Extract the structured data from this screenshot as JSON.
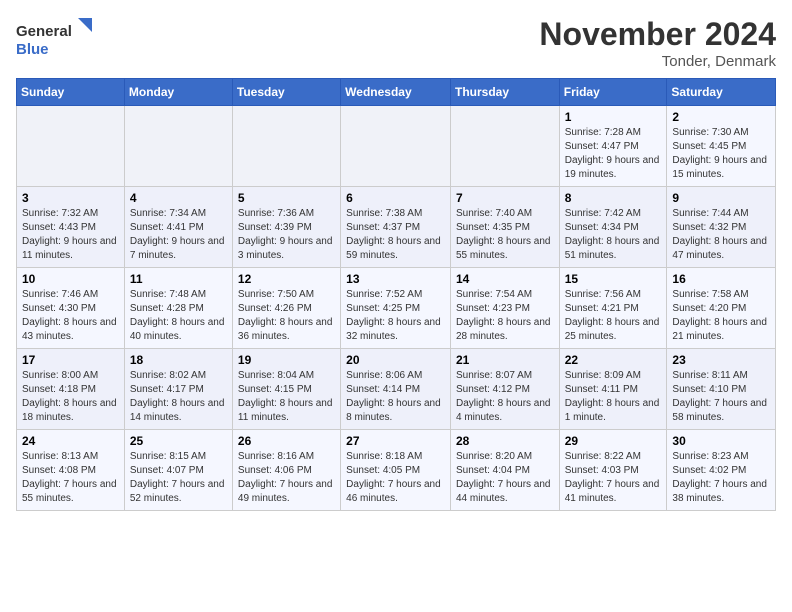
{
  "logo": {
    "line1": "General",
    "line2": "Blue"
  },
  "title": "November 2024",
  "location": "Tonder, Denmark",
  "days_of_week": [
    "Sunday",
    "Monday",
    "Tuesday",
    "Wednesday",
    "Thursday",
    "Friday",
    "Saturday"
  ],
  "weeks": [
    [
      {
        "day": "",
        "sunrise": "",
        "sunset": "",
        "daylight": ""
      },
      {
        "day": "",
        "sunrise": "",
        "sunset": "",
        "daylight": ""
      },
      {
        "day": "",
        "sunrise": "",
        "sunset": "",
        "daylight": ""
      },
      {
        "day": "",
        "sunrise": "",
        "sunset": "",
        "daylight": ""
      },
      {
        "day": "",
        "sunrise": "",
        "sunset": "",
        "daylight": ""
      },
      {
        "day": "1",
        "sunrise": "Sunrise: 7:28 AM",
        "sunset": "Sunset: 4:47 PM",
        "daylight": "Daylight: 9 hours and 19 minutes."
      },
      {
        "day": "2",
        "sunrise": "Sunrise: 7:30 AM",
        "sunset": "Sunset: 4:45 PM",
        "daylight": "Daylight: 9 hours and 15 minutes."
      }
    ],
    [
      {
        "day": "3",
        "sunrise": "Sunrise: 7:32 AM",
        "sunset": "Sunset: 4:43 PM",
        "daylight": "Daylight: 9 hours and 11 minutes."
      },
      {
        "day": "4",
        "sunrise": "Sunrise: 7:34 AM",
        "sunset": "Sunset: 4:41 PM",
        "daylight": "Daylight: 9 hours and 7 minutes."
      },
      {
        "day": "5",
        "sunrise": "Sunrise: 7:36 AM",
        "sunset": "Sunset: 4:39 PM",
        "daylight": "Daylight: 9 hours and 3 minutes."
      },
      {
        "day": "6",
        "sunrise": "Sunrise: 7:38 AM",
        "sunset": "Sunset: 4:37 PM",
        "daylight": "Daylight: 8 hours and 59 minutes."
      },
      {
        "day": "7",
        "sunrise": "Sunrise: 7:40 AM",
        "sunset": "Sunset: 4:35 PM",
        "daylight": "Daylight: 8 hours and 55 minutes."
      },
      {
        "day": "8",
        "sunrise": "Sunrise: 7:42 AM",
        "sunset": "Sunset: 4:34 PM",
        "daylight": "Daylight: 8 hours and 51 minutes."
      },
      {
        "day": "9",
        "sunrise": "Sunrise: 7:44 AM",
        "sunset": "Sunset: 4:32 PM",
        "daylight": "Daylight: 8 hours and 47 minutes."
      }
    ],
    [
      {
        "day": "10",
        "sunrise": "Sunrise: 7:46 AM",
        "sunset": "Sunset: 4:30 PM",
        "daylight": "Daylight: 8 hours and 43 minutes."
      },
      {
        "day": "11",
        "sunrise": "Sunrise: 7:48 AM",
        "sunset": "Sunset: 4:28 PM",
        "daylight": "Daylight: 8 hours and 40 minutes."
      },
      {
        "day": "12",
        "sunrise": "Sunrise: 7:50 AM",
        "sunset": "Sunset: 4:26 PM",
        "daylight": "Daylight: 8 hours and 36 minutes."
      },
      {
        "day": "13",
        "sunrise": "Sunrise: 7:52 AM",
        "sunset": "Sunset: 4:25 PM",
        "daylight": "Daylight: 8 hours and 32 minutes."
      },
      {
        "day": "14",
        "sunrise": "Sunrise: 7:54 AM",
        "sunset": "Sunset: 4:23 PM",
        "daylight": "Daylight: 8 hours and 28 minutes."
      },
      {
        "day": "15",
        "sunrise": "Sunrise: 7:56 AM",
        "sunset": "Sunset: 4:21 PM",
        "daylight": "Daylight: 8 hours and 25 minutes."
      },
      {
        "day": "16",
        "sunrise": "Sunrise: 7:58 AM",
        "sunset": "Sunset: 4:20 PM",
        "daylight": "Daylight: 8 hours and 21 minutes."
      }
    ],
    [
      {
        "day": "17",
        "sunrise": "Sunrise: 8:00 AM",
        "sunset": "Sunset: 4:18 PM",
        "daylight": "Daylight: 8 hours and 18 minutes."
      },
      {
        "day": "18",
        "sunrise": "Sunrise: 8:02 AM",
        "sunset": "Sunset: 4:17 PM",
        "daylight": "Daylight: 8 hours and 14 minutes."
      },
      {
        "day": "19",
        "sunrise": "Sunrise: 8:04 AM",
        "sunset": "Sunset: 4:15 PM",
        "daylight": "Daylight: 8 hours and 11 minutes."
      },
      {
        "day": "20",
        "sunrise": "Sunrise: 8:06 AM",
        "sunset": "Sunset: 4:14 PM",
        "daylight": "Daylight: 8 hours and 8 minutes."
      },
      {
        "day": "21",
        "sunrise": "Sunrise: 8:07 AM",
        "sunset": "Sunset: 4:12 PM",
        "daylight": "Daylight: 8 hours and 4 minutes."
      },
      {
        "day": "22",
        "sunrise": "Sunrise: 8:09 AM",
        "sunset": "Sunset: 4:11 PM",
        "daylight": "Daylight: 8 hours and 1 minute."
      },
      {
        "day": "23",
        "sunrise": "Sunrise: 8:11 AM",
        "sunset": "Sunset: 4:10 PM",
        "daylight": "Daylight: 7 hours and 58 minutes."
      }
    ],
    [
      {
        "day": "24",
        "sunrise": "Sunrise: 8:13 AM",
        "sunset": "Sunset: 4:08 PM",
        "daylight": "Daylight: 7 hours and 55 minutes."
      },
      {
        "day": "25",
        "sunrise": "Sunrise: 8:15 AM",
        "sunset": "Sunset: 4:07 PM",
        "daylight": "Daylight: 7 hours and 52 minutes."
      },
      {
        "day": "26",
        "sunrise": "Sunrise: 8:16 AM",
        "sunset": "Sunset: 4:06 PM",
        "daylight": "Daylight: 7 hours and 49 minutes."
      },
      {
        "day": "27",
        "sunrise": "Sunrise: 8:18 AM",
        "sunset": "Sunset: 4:05 PM",
        "daylight": "Daylight: 7 hours and 46 minutes."
      },
      {
        "day": "28",
        "sunrise": "Sunrise: 8:20 AM",
        "sunset": "Sunset: 4:04 PM",
        "daylight": "Daylight: 7 hours and 44 minutes."
      },
      {
        "day": "29",
        "sunrise": "Sunrise: 8:22 AM",
        "sunset": "Sunset: 4:03 PM",
        "daylight": "Daylight: 7 hours and 41 minutes."
      },
      {
        "day": "30",
        "sunrise": "Sunrise: 8:23 AM",
        "sunset": "Sunset: 4:02 PM",
        "daylight": "Daylight: 7 hours and 38 minutes."
      }
    ]
  ]
}
